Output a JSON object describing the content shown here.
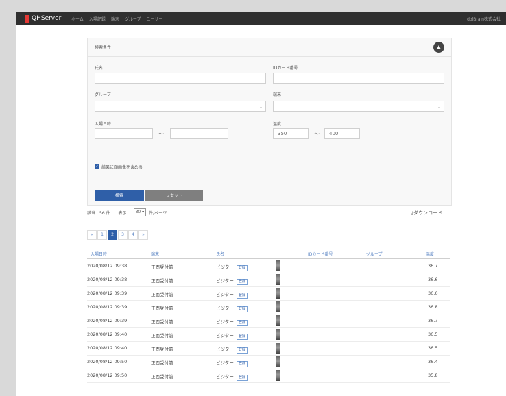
{
  "navbar": {
    "brand": "QHServer",
    "items": [
      "ホーム",
      "入場記録",
      "端末",
      "グループ",
      "ユーザー"
    ],
    "company": "dolBrain株式会社"
  },
  "search_panel": {
    "title": "検索条件",
    "name_label": "氏名",
    "id_card_label": "IDカード番号",
    "group_label": "グループ",
    "terminal_label": "端末",
    "entry_datetime_label": "入場日時",
    "temperature_label": "温度",
    "range_separator": "〜",
    "temp_min": "350",
    "temp_max": "400",
    "checkbox_label": "結果に顔画像を含める",
    "search_button": "検索",
    "reset_button": "リセット"
  },
  "results": {
    "count_text": "該当：56 件",
    "display_label": "表示：",
    "per_page": "30",
    "per_page_suffix": "件/ページ",
    "download_label": "ダウンロード"
  },
  "pagination": [
    "«",
    "1",
    "2",
    "3",
    "4",
    "»"
  ],
  "table": {
    "columns": [
      "入場日時",
      "端末",
      "氏名",
      "IDカード番号",
      "グループ",
      "温度"
    ],
    "rows": [
      {
        "datetime": "2020/08/12 09:38",
        "terminal": "正面受付前",
        "name": "ビジター",
        "tag": "登録",
        "temp": "36.7"
      },
      {
        "datetime": "2020/08/12 09:38",
        "terminal": "正面受付前",
        "name": "ビジター",
        "tag": "登録",
        "temp": "36.6"
      },
      {
        "datetime": "2020/08/12 09:39",
        "terminal": "正面受付前",
        "name": "ビジター",
        "tag": "登録",
        "temp": "36.6"
      },
      {
        "datetime": "2020/08/12 09:39",
        "terminal": "正面受付前",
        "name": "ビジター",
        "tag": "登録",
        "temp": "36.8"
      },
      {
        "datetime": "2020/08/12 09:39",
        "terminal": "正面受付前",
        "name": "ビジター",
        "tag": "登録",
        "temp": "36.7"
      },
      {
        "datetime": "2020/08/12 09:40",
        "terminal": "正面受付前",
        "name": "ビジター",
        "tag": "登録",
        "temp": "36.5"
      },
      {
        "datetime": "2020/08/12 09:40",
        "terminal": "正面受付前",
        "name": "ビジター",
        "tag": "登録",
        "temp": "36.5"
      },
      {
        "datetime": "2020/08/12 09:50",
        "terminal": "正面受付前",
        "name": "ビジター",
        "tag": "登録",
        "temp": "36.4"
      },
      {
        "datetime": "2020/08/12 09:50",
        "terminal": "正面受付前",
        "name": "ビジター",
        "tag": "登録",
        "temp": "35.8"
      }
    ]
  }
}
